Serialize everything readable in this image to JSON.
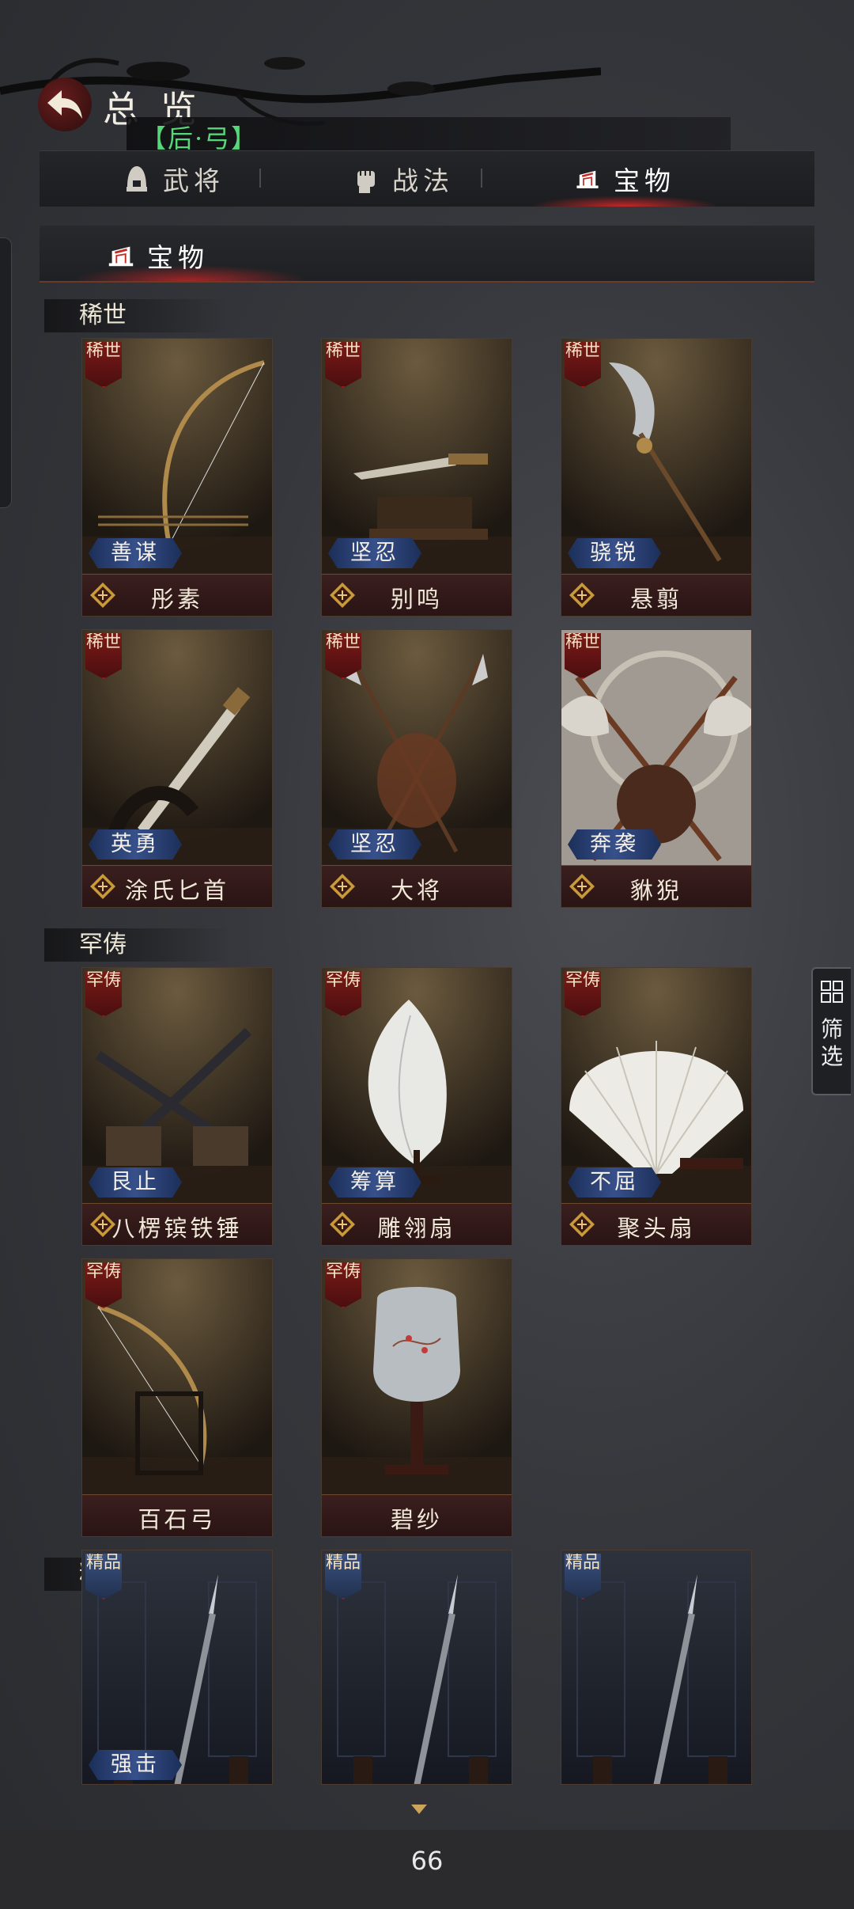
{
  "header": {
    "title": "总 览",
    "search_tag": "【后·弓】"
  },
  "tabs": [
    {
      "label": "武将",
      "icon": "helmet-icon",
      "active": false
    },
    {
      "label": "战法",
      "icon": "fist-icon",
      "active": false
    },
    {
      "label": "宝物",
      "icon": "treasure-icon",
      "active": true
    }
  ],
  "section": {
    "label": "宝物",
    "icon": "treasure-icon"
  },
  "categories": {
    "rare": "稀世",
    "uncommon": "罕俦",
    "fine": "精品"
  },
  "cards": [
    {
      "name": "彤素",
      "rarity": "稀世",
      "skill": "善谋",
      "grade_icon": "grade-badge-icon",
      "art": "bow"
    },
    {
      "name": "别鸣",
      "rarity": "稀世",
      "skill": "坚忍",
      "grade_icon": "grade-badge-icon",
      "art": "dagger"
    },
    {
      "name": "悬翦",
      "rarity": "稀世",
      "skill": "骁锐",
      "grade_icon": "grade-badge-icon",
      "art": "glaive"
    },
    {
      "name": "涂氏匕首",
      "rarity": "稀世",
      "skill": "英勇",
      "grade_icon": "grade-badge-icon",
      "art": "sword"
    },
    {
      "name": "大将",
      "rarity": "稀世",
      "skill": "坚忍",
      "grade_icon": "grade-badge-icon",
      "art": "crossed-spears"
    },
    {
      "name": "貅猊",
      "rarity": "稀世",
      "skill": "奔袭",
      "grade_icon": "grade-badge-icon",
      "art": "crossed-axes"
    },
    {
      "name": "八楞镔铁锤",
      "rarity": "罕俦",
      "skill": "艮止",
      "grade_icon": "grade-badge-icon",
      "art": "hammers"
    },
    {
      "name": "雕翎扇",
      "rarity": "罕俦",
      "skill": "筹算",
      "grade_icon": "grade-badge-icon",
      "art": "feather-fan"
    },
    {
      "name": "聚头扇",
      "rarity": "罕俦",
      "skill": "不屈",
      "grade_icon": "grade-badge-icon",
      "art": "folding-fan"
    },
    {
      "name": "百石弓",
      "rarity": "罕俦",
      "skill": "",
      "grade_icon": "",
      "art": "bow-stand"
    },
    {
      "name": "碧纱",
      "rarity": "罕俦",
      "skill": "",
      "grade_icon": "",
      "art": "screen-fan"
    },
    {
      "name": "",
      "rarity": "精品",
      "skill": "强击",
      "grade_icon": "",
      "art": "spear"
    },
    {
      "name": "",
      "rarity": "精品",
      "skill": "",
      "grade_icon": "",
      "art": "spear"
    },
    {
      "name": "",
      "rarity": "精品",
      "skill": "",
      "grade_icon": "",
      "art": "spear"
    }
  ],
  "filter": {
    "label": "筛选",
    "icon": "filter-grid-icon"
  },
  "footer": {
    "page": "66"
  },
  "colors": {
    "accent_red": "#c42a22",
    "skill_blue": "#37508a",
    "search_green": "#57d67a"
  }
}
